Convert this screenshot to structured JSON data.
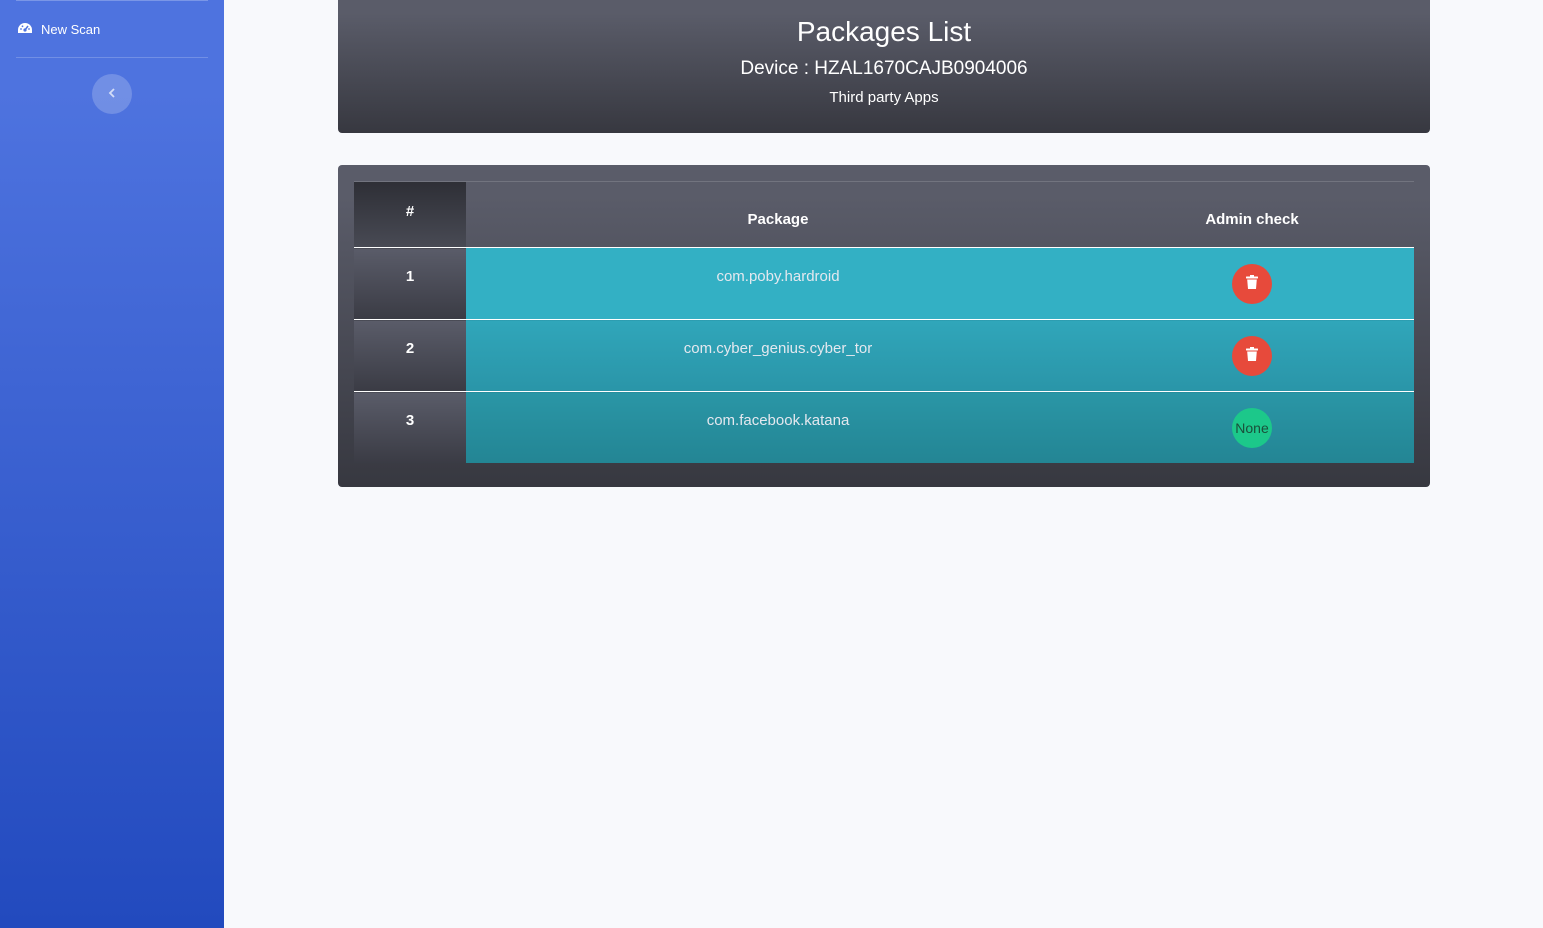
{
  "sidebar": {
    "nav_items": [
      {
        "label": "New Scan",
        "icon": "dashboard-gauge-icon"
      }
    ],
    "toggle_icon": "chevron-left-icon"
  },
  "header": {
    "title": "Packages List",
    "device": "Device : HZAL1670CAJB0904006",
    "subtitle": "Third party Apps"
  },
  "table": {
    "columns": [
      "#",
      "Package",
      "Admin check"
    ],
    "rows": [
      {
        "num": "1",
        "package": "com.poby.hardroid",
        "admin": "delete",
        "admin_icon": "trash-icon"
      },
      {
        "num": "2",
        "package": "com.cyber_genius.cyber_tor",
        "admin": "delete",
        "admin_icon": "trash-icon"
      },
      {
        "num": "3",
        "package": "com.facebook.katana",
        "admin": "None"
      }
    ]
  },
  "colors": {
    "sidebar_top": "#4e73df",
    "sidebar_bottom": "#224abe",
    "row_teal": "#33b0c4",
    "delete_red": "#e74a3b",
    "none_green": "#1cc88a"
  }
}
